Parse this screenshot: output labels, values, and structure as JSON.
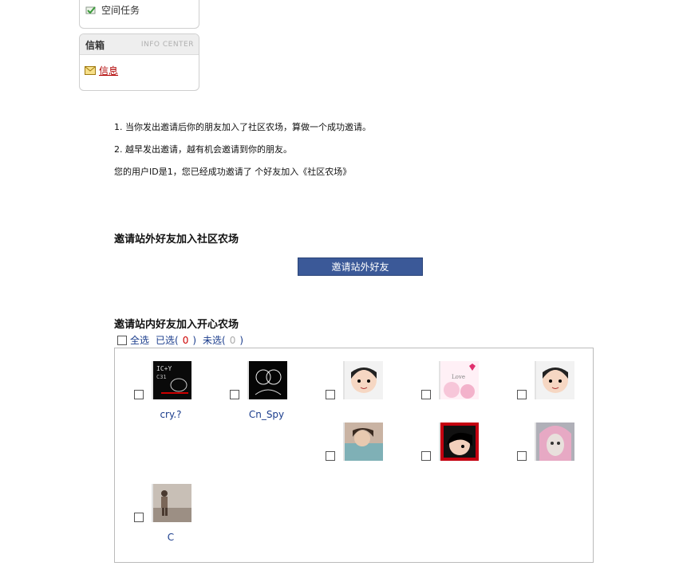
{
  "sidebar": {
    "task_label": "空间任务",
    "info_title": "信箱",
    "info_title_en": "INFO CENTER",
    "info_link": "信息"
  },
  "rules": [
    "1. 当你发出邀请后你的朋友加入了社区农场，算做一个成功邀请。",
    "2. 越早发出邀请，越有机会邀请到你的朋友。",
    "您的用户ID是1，您已经成功邀请了  个好友加入《社区农场》"
  ],
  "external": {
    "title": "邀请站外好友加入社区农场",
    "button_label": "邀请站外好友"
  },
  "internal": {
    "title": "邀请站内好友加入开心农场",
    "select_all": "全选",
    "selected_label": "已选(",
    "selected_count": "0",
    "unselected_label": "未选(",
    "unselected_count": "0",
    "close_paren": ")"
  },
  "friends": [
    {
      "name": "cry.?",
      "avatar": "dark-sketch"
    },
    {
      "name": "Cn_Spy",
      "avatar": "couple-sketch"
    },
    {
      "name": "",
      "avatar": "cartoon-boy"
    },
    {
      "name": "",
      "avatar": "pink-hearts"
    },
    {
      "name": "",
      "avatar": "cartoon-boy"
    },
    {
      "name": "",
      "avatar": "photo-girl"
    },
    {
      "name": "",
      "avatar": "emo-cartoon"
    },
    {
      "name": "",
      "avatar": "pink-hair-girl"
    },
    {
      "name": "C",
      "avatar": "beach-photo"
    }
  ]
}
